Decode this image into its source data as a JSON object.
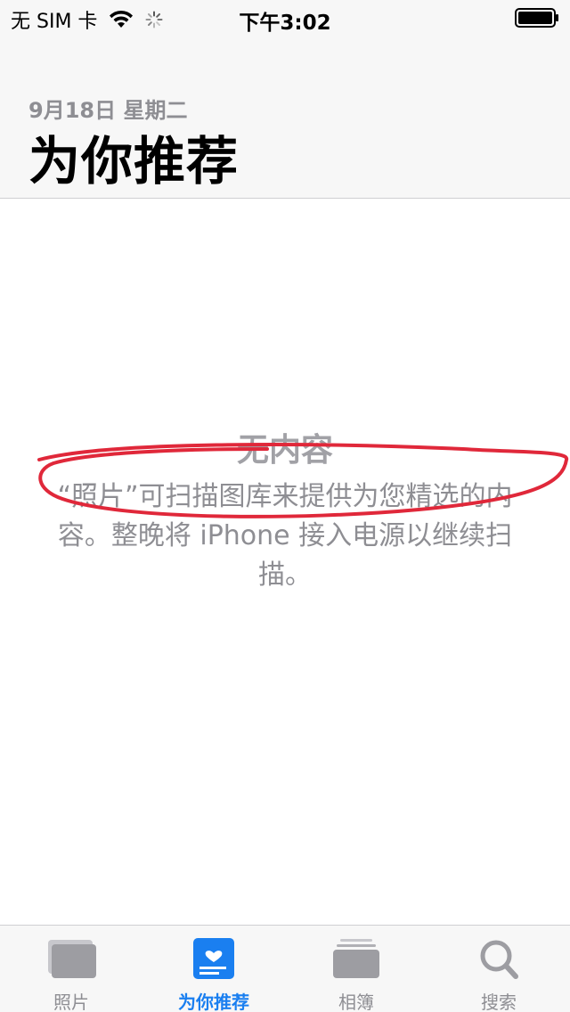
{
  "status_bar": {
    "carrier": "无 SIM 卡",
    "time": "下午3:02"
  },
  "header": {
    "date": "9月18日 星期二",
    "title": "为你推荐"
  },
  "empty_state": {
    "title": "无内容",
    "message": "“照片”可扫描图库来提供为您精选的内容。整晚将 iPhone 接入电源以继续扫描。"
  },
  "annotation_color": "#e0283a",
  "accent_color": "#1a7ff0",
  "tabs": [
    {
      "label": "照片",
      "icon": "photos-icon",
      "active": false
    },
    {
      "label": "为你推荐",
      "icon": "for-you-icon",
      "active": true
    },
    {
      "label": "相簿",
      "icon": "albums-icon",
      "active": false
    },
    {
      "label": "搜索",
      "icon": "search-icon",
      "active": false
    }
  ]
}
